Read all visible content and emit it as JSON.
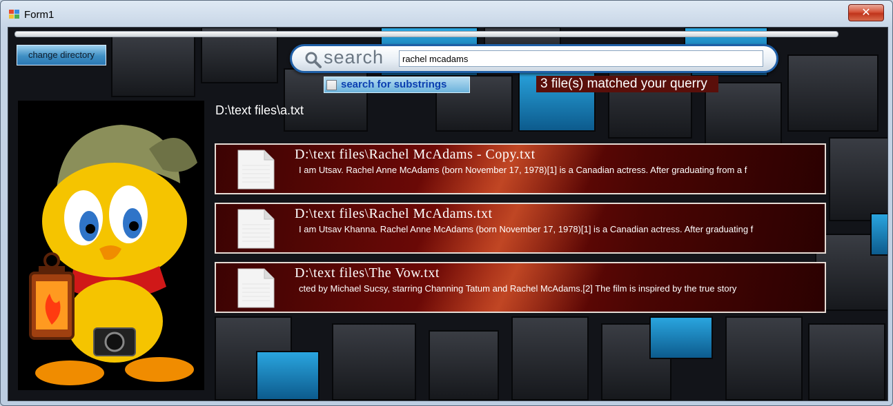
{
  "window": {
    "title": "Form1",
    "close_glyph": "✕"
  },
  "toolbar": {
    "change_dir_label": "change directory",
    "search_word": "search",
    "search_query": "rachel mcadams",
    "substring_label": "search for substrings",
    "substring_checked": false,
    "match_status": "3 file(s) matched your querry"
  },
  "current_file": "D:\\text files\\a.txt",
  "results": [
    {
      "title": "D:\\text files\\Rachel McAdams - Copy.txt",
      "snippet": "I am Utsav. Rachel Anne McAdams (born November 17, 1978)[1] is a Canadian actress. After graduating from a f"
    },
    {
      "title": "D:\\text files\\Rachel McAdams.txt",
      "snippet": "I am Utsav Khanna. Rachel Anne McAdams (born November 17, 1978)[1] is a Canadian actress. After graduating f"
    },
    {
      "title": "D:\\text files\\The Vow.txt",
      "snippet": "cted by Michael Sucsy, starring Channing Tatum and Rachel McAdams.[2] The film is inspired by the true story"
    }
  ],
  "icons": {
    "app": "form-app-icon",
    "search": "magnifier-icon",
    "file": "document-icon",
    "mascot": "tweety-lantern-camera-image"
  },
  "colors": {
    "accent_blue": "#1f5fa6",
    "result_red": "#7a0b07",
    "status_bg": "#5a0f0a",
    "substring_text": "#0b3fb0"
  }
}
